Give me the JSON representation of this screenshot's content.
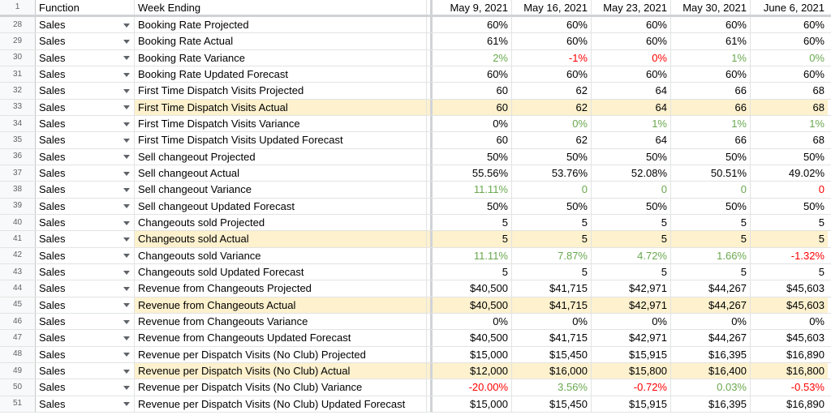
{
  "sheet": {
    "header": {
      "row_number": "1",
      "function": "Function",
      "week_ending": "Week Ending",
      "dates": [
        "May 9, 2021",
        "May 16, 2021",
        "May 23, 2021",
        "May 30, 2021",
        "June 6, 2021"
      ]
    },
    "colors": {
      "highlight": "#fdf1ce",
      "positive": "#6aa84f",
      "negative": "#ff0000"
    },
    "rows": [
      {
        "num": "28",
        "fn": "Sales",
        "metric": "Booking Rate Projected",
        "values": [
          "60%",
          "60%",
          "60%",
          "60%",
          "60%"
        ],
        "colors": [
          "",
          "",
          "",
          "",
          ""
        ],
        "highlight": false
      },
      {
        "num": "29",
        "fn": "Sales",
        "metric": "Booking Rate Actual",
        "values": [
          "61%",
          "60%",
          "60%",
          "61%",
          "60%"
        ],
        "colors": [
          "",
          "",
          "",
          "",
          ""
        ],
        "highlight": false
      },
      {
        "num": "30",
        "fn": "Sales",
        "metric": "Booking Rate Variance",
        "values": [
          "2%",
          "-1%",
          "0%",
          "1%",
          "0%"
        ],
        "colors": [
          "pos",
          "neg",
          "neg",
          "pos",
          "pos"
        ],
        "highlight": false
      },
      {
        "num": "31",
        "fn": "Sales",
        "metric": "Booking Rate Updated Forecast",
        "values": [
          "60%",
          "60%",
          "60%",
          "60%",
          "60%"
        ],
        "colors": [
          "",
          "",
          "",
          "",
          ""
        ],
        "highlight": false
      },
      {
        "num": "32",
        "fn": "Sales",
        "metric": "First Time Dispatch Visits Projected",
        "values": [
          "60",
          "62",
          "64",
          "66",
          "68"
        ],
        "colors": [
          "",
          "",
          "",
          "",
          ""
        ],
        "highlight": false
      },
      {
        "num": "33",
        "fn": "Sales",
        "metric": "First Time Dispatch Visits Actual",
        "values": [
          "60",
          "62",
          "64",
          "66",
          "68"
        ],
        "colors": [
          "",
          "",
          "",
          "",
          ""
        ],
        "highlight": true
      },
      {
        "num": "34",
        "fn": "Sales",
        "metric": "First Time Dispatch Visits Variance",
        "values": [
          "0%",
          "0%",
          "1%",
          "1%",
          "1%"
        ],
        "colors": [
          "",
          "pos",
          "pos",
          "pos",
          "pos"
        ],
        "highlight": false
      },
      {
        "num": "35",
        "fn": "Sales",
        "metric": "First Time Dispatch Visits Updated Forecast",
        "values": [
          "60",
          "62",
          "64",
          "66",
          "68"
        ],
        "colors": [
          "",
          "",
          "",
          "",
          ""
        ],
        "highlight": false
      },
      {
        "num": "36",
        "fn": "Sales",
        "metric": "Sell changeout Projected",
        "values": [
          "50%",
          "50%",
          "50%",
          "50%",
          "50%"
        ],
        "colors": [
          "",
          "",
          "",
          "",
          ""
        ],
        "highlight": false
      },
      {
        "num": "37",
        "fn": "Sales",
        "metric": "Sell changeout Actual",
        "values": [
          "55.56%",
          "53.76%",
          "52.08%",
          "50.51%",
          "49.02%"
        ],
        "colors": [
          "",
          "",
          "",
          "",
          ""
        ],
        "highlight": false
      },
      {
        "num": "38",
        "fn": "Sales",
        "metric": "Sell changeout Variance",
        "values": [
          "11.11%",
          "0",
          "0",
          "0",
          "0"
        ],
        "colors": [
          "pos",
          "pos",
          "pos",
          "pos",
          "neg"
        ],
        "highlight": false
      },
      {
        "num": "39",
        "fn": "Sales",
        "metric": "Sell changeout Updated Forecast",
        "values": [
          "50%",
          "50%",
          "50%",
          "50%",
          "50%"
        ],
        "colors": [
          "",
          "",
          "",
          "",
          ""
        ],
        "highlight": false
      },
      {
        "num": "40",
        "fn": "Sales",
        "metric": "Changeouts sold Projected",
        "values": [
          "5",
          "5",
          "5",
          "5",
          "5"
        ],
        "colors": [
          "",
          "",
          "",
          "",
          ""
        ],
        "highlight": false
      },
      {
        "num": "41",
        "fn": "Sales",
        "metric": "Changeouts sold Actual",
        "values": [
          "5",
          "5",
          "5",
          "5",
          "5"
        ],
        "colors": [
          "",
          "",
          "",
          "",
          ""
        ],
        "highlight": true
      },
      {
        "num": "42",
        "fn": "Sales",
        "metric": "Changeouts sold Variance",
        "values": [
          "11.11%",
          "7.87%",
          "4.72%",
          "1.66%",
          "-1.32%"
        ],
        "colors": [
          "pos",
          "pos",
          "pos",
          "pos",
          "neg"
        ],
        "highlight": false
      },
      {
        "num": "43",
        "fn": "Sales",
        "metric": "Changeouts sold Updated Forecast",
        "values": [
          "5",
          "5",
          "5",
          "5",
          "5"
        ],
        "colors": [
          "",
          "",
          "",
          "",
          ""
        ],
        "highlight": false
      },
      {
        "num": "44",
        "fn": "Sales",
        "metric": "Revenue from Changeouts Projected",
        "values": [
          "$40,500",
          "$41,715",
          "$42,971",
          "$44,267",
          "$45,603"
        ],
        "colors": [
          "",
          "",
          "",
          "",
          ""
        ],
        "highlight": false
      },
      {
        "num": "45",
        "fn": "Sales",
        "metric": "Revenue from Changeouts Actual",
        "values": [
          "$40,500",
          "$41,715",
          "$42,971",
          "$44,267",
          "$45,603"
        ],
        "colors": [
          "",
          "",
          "",
          "",
          ""
        ],
        "highlight": true
      },
      {
        "num": "46",
        "fn": "Sales",
        "metric": "Revenue from Changeouts Variance",
        "values": [
          "0%",
          "0%",
          "0%",
          "0%",
          "0%"
        ],
        "colors": [
          "",
          "",
          "",
          "",
          ""
        ],
        "highlight": false
      },
      {
        "num": "47",
        "fn": "Sales",
        "metric": "Revenue from Changeouts Updated Forecast",
        "values": [
          "$40,500",
          "$41,715",
          "$42,971",
          "$44,267",
          "$45,603"
        ],
        "colors": [
          "",
          "",
          "",
          "",
          ""
        ],
        "highlight": false
      },
      {
        "num": "48",
        "fn": "Sales",
        "metric": "Revenue per Dispatch Visits (No Club) Projected",
        "values": [
          "$15,000",
          "$15,450",
          "$15,915",
          "$16,395",
          "$16,890"
        ],
        "colors": [
          "",
          "",
          "",
          "",
          ""
        ],
        "highlight": false
      },
      {
        "num": "49",
        "fn": "Sales",
        "metric": "Revenue per Dispatch Visits (No Club) Actual",
        "values": [
          "$12,000",
          "$16,000",
          "$15,800",
          "$16,400",
          "$16,800"
        ],
        "colors": [
          "",
          "",
          "",
          "",
          ""
        ],
        "highlight": true
      },
      {
        "num": "50",
        "fn": "Sales",
        "metric": "Revenue per Dispatch Visits (No Club) Variance",
        "values": [
          "-20.00%",
          "3.56%",
          "-0.72%",
          "0.03%",
          "-0.53%"
        ],
        "colors": [
          "neg",
          "pos",
          "neg",
          "pos",
          "neg"
        ],
        "highlight": false
      },
      {
        "num": "51",
        "fn": "Sales",
        "metric": "Revenue per Dispatch Visits (No Club) Updated Forecast",
        "values": [
          "$15,000",
          "$15,450",
          "$15,915",
          "$16,395",
          "$16,890"
        ],
        "colors": [
          "",
          "",
          "",
          "",
          ""
        ],
        "highlight": false
      }
    ]
  }
}
